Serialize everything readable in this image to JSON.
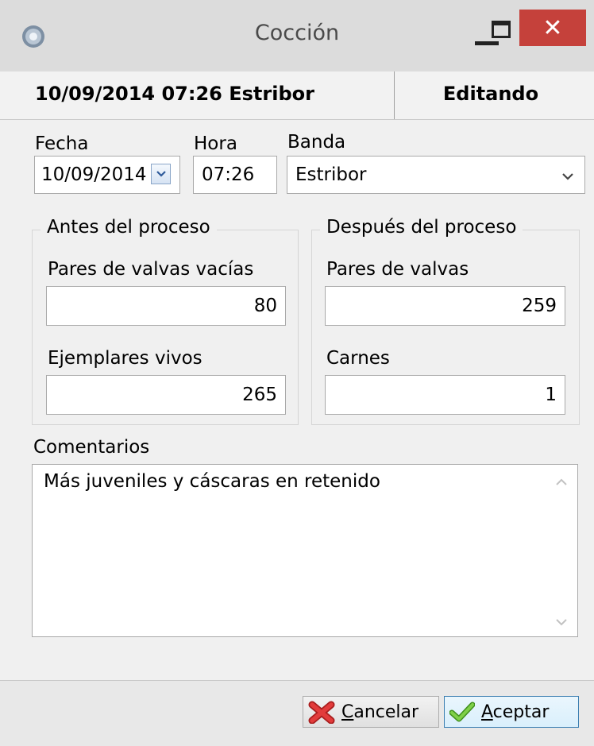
{
  "window": {
    "title": "Cocción",
    "close_glyph": "✕",
    "icons": [
      "app-icon",
      "minimize-icon",
      "maximize-icon",
      "close-icon"
    ]
  },
  "header": {
    "info": "10/09/2014 07:26 Estribor",
    "status": "Editando"
  },
  "form": {
    "fecha_label": "Fecha",
    "fecha_value": "10/09/2014",
    "hora_label": "Hora",
    "hora_value": "07:26",
    "banda_label": "Banda",
    "banda_value": "Estribor"
  },
  "antes": {
    "title": "Antes del proceso",
    "pares_label": "Pares de valvas vacías",
    "pares_value": "80",
    "vivos_label": "Ejemplares vivos",
    "vivos_value": "265"
  },
  "despues": {
    "title": "Después del proceso",
    "pares_label": "Pares de valvas",
    "pares_value": "259",
    "carnes_label": "Carnes",
    "carnes_value": "1"
  },
  "comments": {
    "label": "Comentarios",
    "value": "Más juveniles y cáscaras en retenido"
  },
  "buttons": {
    "cancel_accel": "C",
    "cancel_rest": "ancelar",
    "accept_accel": "A",
    "accept_rest": "ceptar"
  },
  "colors": {
    "window_bg": "#f0f0f0",
    "close_button": "#c5413b",
    "cancel_icon": "#d32f2f",
    "accept_icon": "#5cb82c"
  }
}
